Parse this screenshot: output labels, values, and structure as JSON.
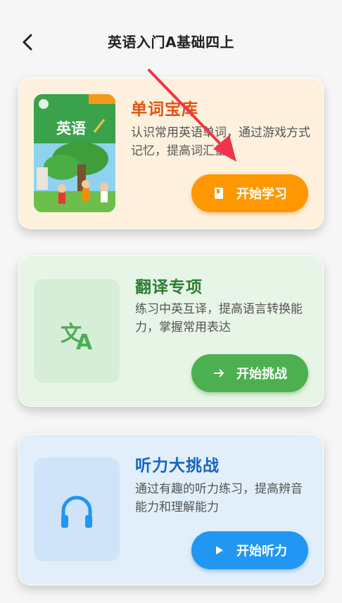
{
  "header": {
    "title": "英语入门A基础四上"
  },
  "icons": {
    "back": "chevron-left-icon",
    "book": "book-icon",
    "translate": "translate-icon",
    "headphones": "headphones-icon",
    "arrow_right": "arrow-right-icon",
    "play": "play-icon",
    "annotation": "red-pointer-arrow"
  },
  "cards": {
    "vocab": {
      "title": "单词宝库",
      "description": "认识常用英语单词，通过游戏方式记忆，提高词汇量",
      "button_label": "开始学习",
      "cover_text": "英语"
    },
    "translation": {
      "title": "翻译专项",
      "description": "练习中英互译，提高语言转换能力，掌握常用表达",
      "button_label": "开始挑战"
    },
    "listening": {
      "title": "听力大挑战",
      "description": "通过有趣的听力练习，提高辨音能力和理解能力",
      "button_label": "开始听力"
    }
  },
  "colors": {
    "vocab_accent": "#ff9800",
    "vocab_title": "#e8500e",
    "translation_accent": "#4caf50",
    "translation_title": "#2e7d32",
    "listening_accent": "#2196f3",
    "listening_title": "#1565c0",
    "annotation_arrow": "#f0344e"
  }
}
